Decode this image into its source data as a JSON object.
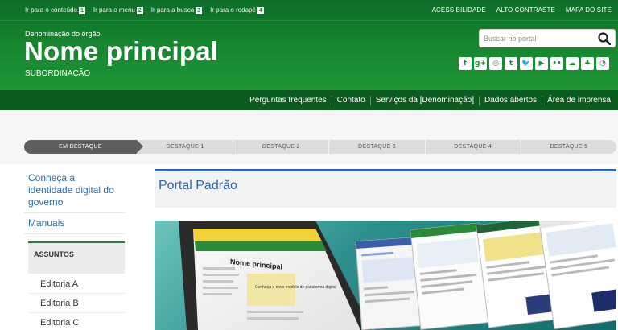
{
  "skip_links": [
    {
      "label": "Ir para o conteúdo",
      "key": "1"
    },
    {
      "label": "Ir para o menu",
      "key": "2"
    },
    {
      "label": "Ir para a busca",
      "key": "3"
    },
    {
      "label": "Ir para o rodapé",
      "key": "4"
    }
  ],
  "utility_links": [
    "ACESSIBILIDADE",
    "ALTO CONTRASTE",
    "MAPA DO SITE"
  ],
  "header": {
    "org": "Denominação do órgão",
    "title": "Nome principal",
    "subtitle": "SUBORDINAÇÃO"
  },
  "search": {
    "placeholder": "Buscar no portal"
  },
  "social": [
    {
      "name": "facebook-icon",
      "glyph": "f"
    },
    {
      "name": "google-plus-icon",
      "glyph": "g+"
    },
    {
      "name": "instagram-icon",
      "glyph": "◎"
    },
    {
      "name": "tumblr-icon",
      "glyph": "t"
    },
    {
      "name": "twitter-icon",
      "glyph": "🐦"
    },
    {
      "name": "youtube-icon",
      "glyph": "▶"
    },
    {
      "name": "flickr-icon",
      "glyph": "••"
    },
    {
      "name": "soundcloud-icon",
      "glyph": "☁"
    },
    {
      "name": "slideshare-icon",
      "glyph": "♣"
    },
    {
      "name": "rss-icon",
      "glyph": "◔"
    }
  ],
  "nav": [
    "Perguntas frequentes",
    "Contato",
    "Serviços da [Denominação]",
    "Dados abertos",
    "Área de imprensa"
  ],
  "highlight_tabs": [
    "EM DESTAQUE",
    "DESTAQUE 1",
    "DESTAQUE 2",
    "DESTAQUE 3",
    "DESTAQUE 4",
    "DESTAQUE 5"
  ],
  "left_links": [
    "Conheça a identidade digital do governo",
    "Manuais"
  ],
  "assuntos": {
    "title": "ASSUNTOS",
    "items": [
      "Editoria A",
      "Editoria B",
      "Editoria C"
    ]
  },
  "main": {
    "portal_title": "Portal Padrão",
    "banner": {
      "screen_title": "Nome principal",
      "screen_text": "Conheça o novo modelo de plataforma digital"
    }
  },
  "colors": {
    "header_green": "#17862f",
    "nav_dark_green": "#0b5a1f",
    "link_blue": "#2a6bb5",
    "portal_blue": "#2f65b0"
  }
}
